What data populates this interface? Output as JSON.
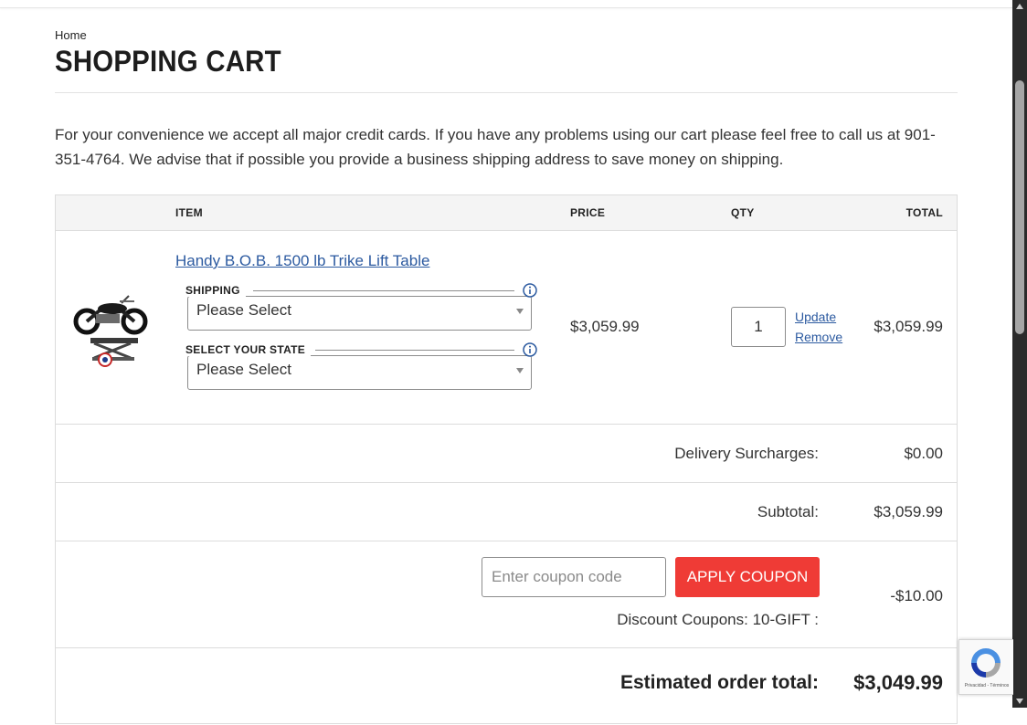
{
  "breadcrumb": "Home",
  "page_title": "SHOPPING CART",
  "intro": "For your convenience we accept all major credit cards. If you have any problems using our cart please feel free to call us at 901-351-4764. We advise that if possible you provide a business shipping address to save money on shipping.",
  "table": {
    "headers": {
      "item": "ITEM",
      "price": "PRICE",
      "qty": "QTY",
      "total": "TOTAL"
    }
  },
  "item": {
    "name": "Handy B.O.B. 1500 lb Trike Lift Table",
    "shipping_label": "SHIPPING",
    "shipping_value": "Please Select",
    "state_label": "SELECT YOUR STATE",
    "state_value": "Please Select",
    "price": "$3,059.99",
    "qty": "1",
    "update_label": "Update",
    "remove_label": "Remove",
    "total": "$3,059.99"
  },
  "summary": {
    "delivery_label": "Delivery Surcharges:",
    "delivery_value": "$0.00",
    "subtotal_label": "Subtotal:",
    "subtotal_value": "$3,059.99",
    "coupon_placeholder": "Enter coupon code",
    "coupon_button": "APPLY COUPON",
    "discount_label": "Discount Coupons: 10-GIFT :",
    "discount_value": "-$10.00",
    "estimated_label": "Estimated order total:",
    "estimated_value": "$3,049.99"
  },
  "recaptcha": {
    "text": "Privacidad - Términos"
  },
  "colors": {
    "link": "#2c5aa0",
    "coupon_button": "#ef3b36",
    "header_bg": "#f4f4f4",
    "info_icon": "#2c5aa0"
  },
  "icons": {
    "info": "info-icon",
    "dropdown": "chevron-down-icon",
    "recaptcha": "recaptcha-logo-icon"
  }
}
